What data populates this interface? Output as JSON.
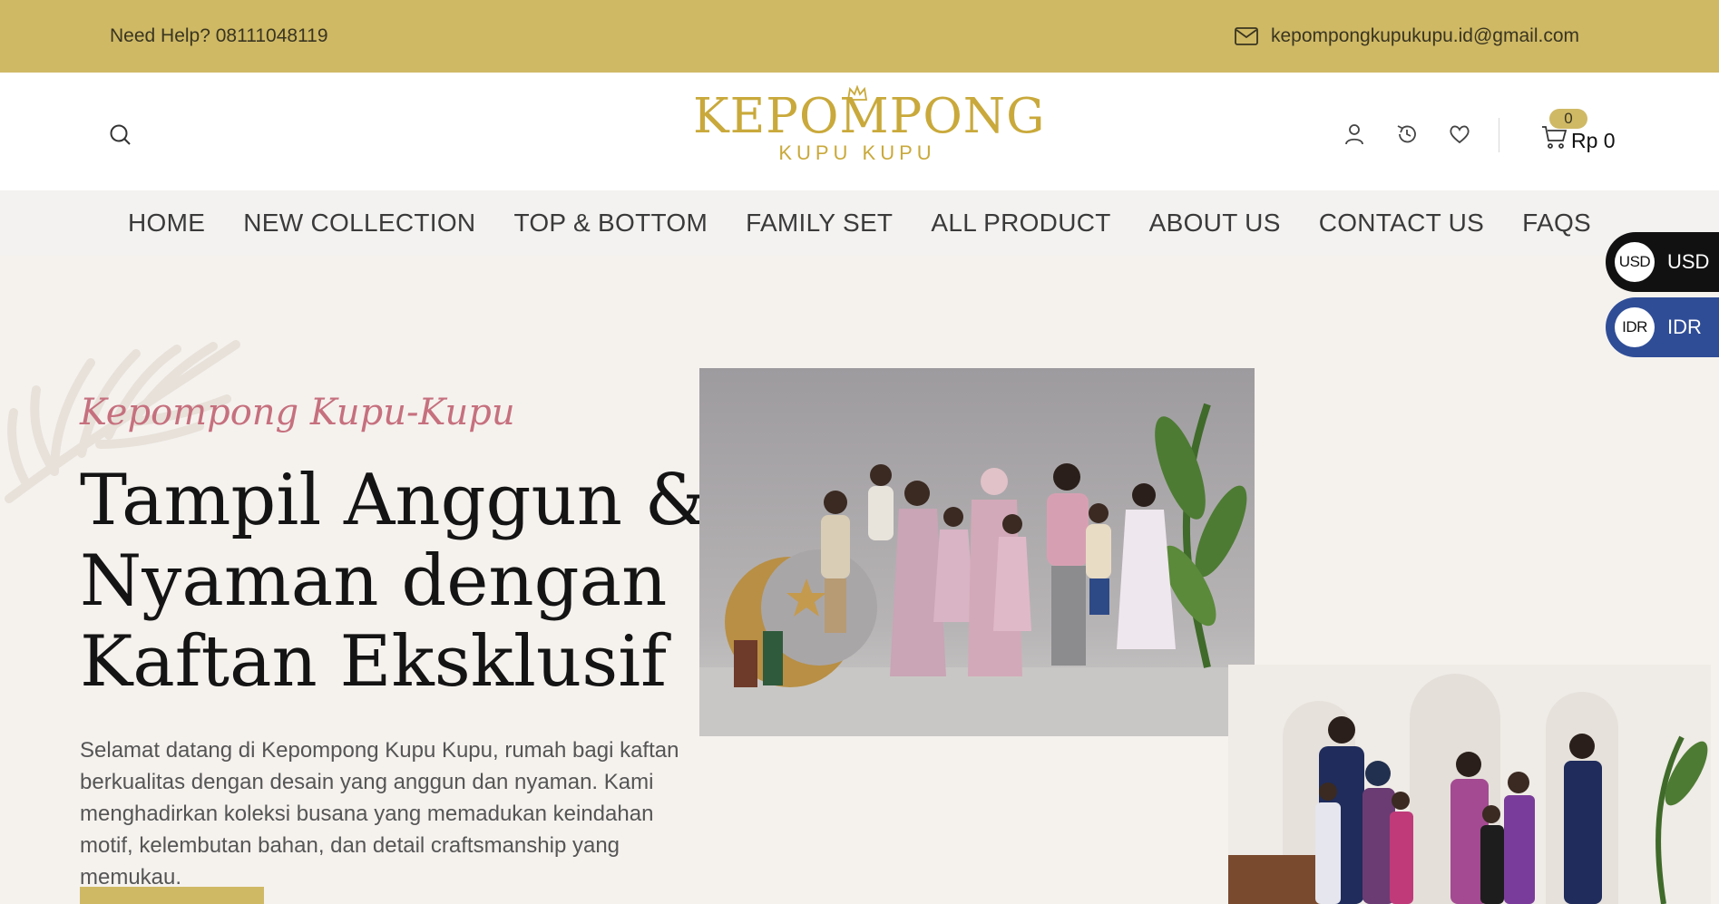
{
  "topbar": {
    "help": "Need Help? 08111048119",
    "email": "kepompongkupukupu.id@gmail.com"
  },
  "header": {
    "logo_main": "KEPOMPONG",
    "logo_sub": "KUPU KUPU",
    "cart_count": "0",
    "cart_total": "Rp 0"
  },
  "nav": {
    "items": [
      "HOME",
      "NEW COLLECTION",
      "TOP & BOTTOM",
      "FAMILY SET",
      "ALL PRODUCT",
      "ABOUT US",
      "CONTACT US",
      "FAQS"
    ]
  },
  "currency": {
    "usd_badge": "USD",
    "usd_label": "USD",
    "idr_badge": "IDR",
    "idr_label": "IDR"
  },
  "hero": {
    "script": "Kepompong Kupu-Kupu",
    "headline": "Tampil Anggun & Nyaman dengan Kaftan Eksklusif",
    "description": "Selamat datang di Kepompong Kupu Kupu, rumah bagi kaftan berkualitas dengan desain yang anggun dan nyaman. Kami menghadirkan koleksi busana yang memadukan keindahan motif, kelembutan bahan, dan detail craftsmanship yang memukau."
  },
  "colors": {
    "accent_gold": "#cfb965",
    "logo_gold": "#c9a93b",
    "script_pink": "#c6707e",
    "idr_blue": "#2f4d97"
  }
}
